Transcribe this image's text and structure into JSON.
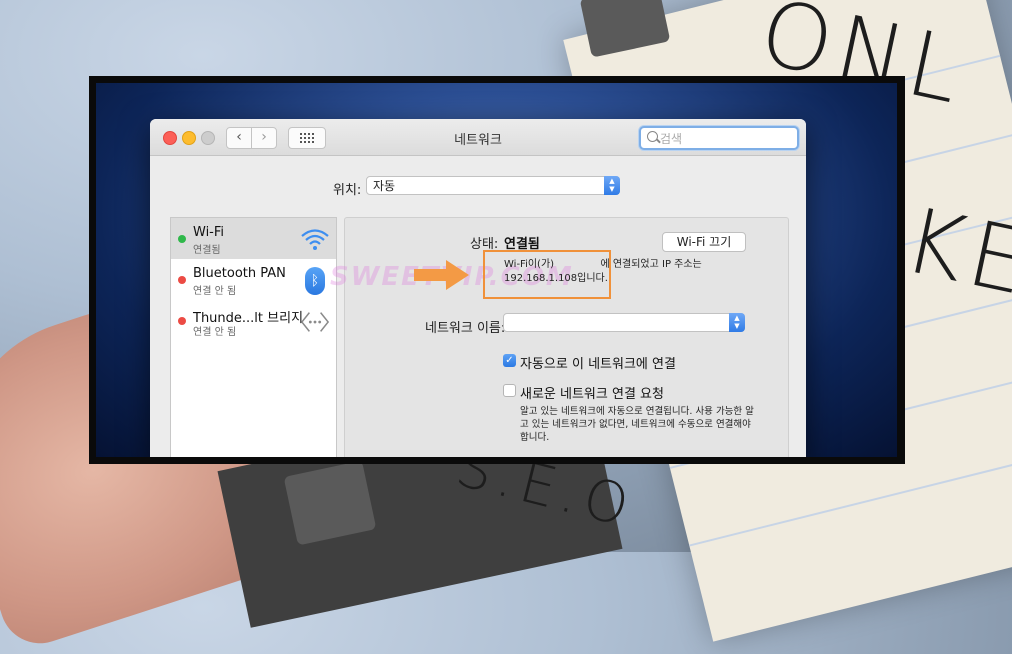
{
  "window": {
    "title": "네트워크",
    "search_placeholder": "검색"
  },
  "location": {
    "label": "위치:",
    "value": "자동"
  },
  "services": [
    {
      "name": "Wi-Fi",
      "status": "연결됨",
      "status_color": "#2fb84a",
      "icon": "wifi-icon"
    },
    {
      "name": "Bluetooth PAN",
      "status": "연결 안 됨",
      "status_color": "#ec4b44",
      "icon": "bluetooth-icon"
    },
    {
      "name": "Thunde...lt 브리지",
      "status": "연결 안 됨",
      "status_color": "#ec4b44",
      "icon": "thunderbolt-bridge-icon"
    }
  ],
  "detail": {
    "status_label": "상태:",
    "status_value": "연결됨",
    "wifi_off_button": "Wi-Fi 끄기",
    "description_line1_a": "Wi-Fi이(가)",
    "description_line1_b": "에 연결되었고 IP 주소는",
    "description_line2": "192.168.1.108입니다.",
    "network_name_label": "네트워크 이름:",
    "network_name_value": "",
    "auto_join_label": "자동으로 이 네트워크에 연결",
    "auto_join_checked": true,
    "ask_join_label": "새로운 네트워크 연결 요청",
    "ask_join_checked": false,
    "help_text": "알고 있는 네트워크에 자동으로 연결됩니다. 사용 가능한 알고 있는 네트워크가 없다면, 네트워크에 수동으로 연결해야 합니다."
  },
  "colors": {
    "accent": "#2b79e3",
    "highlight_box": "#f0913a",
    "connected": "#2fb84a",
    "disconnected": "#ec4b44"
  }
}
